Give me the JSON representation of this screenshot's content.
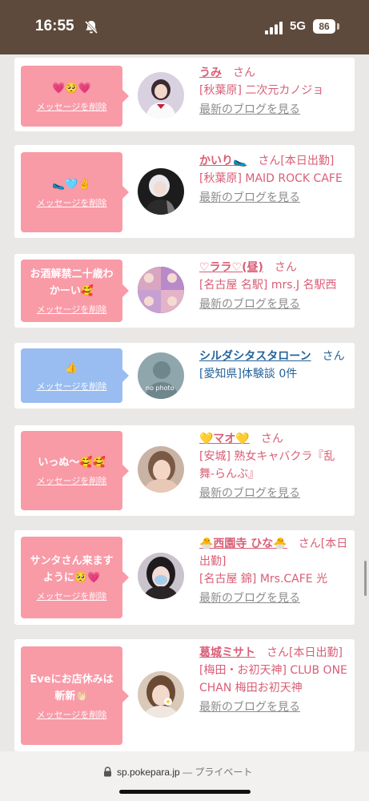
{
  "status_bar": {
    "time": "16:55",
    "network": "5G",
    "battery": "86"
  },
  "url_bar": {
    "domain": "sp.pokepara.jp",
    "suffix": "— プライベート"
  },
  "cards": [
    {
      "message": "💗🥺💗",
      "delete_label": "メッセージを削除",
      "name": "うみ",
      "name_suffix": "さん",
      "location": "[秋葉原] 二次元カノジョ",
      "blog_link": "最新のブログを見る"
    },
    {
      "message": "🥿🩵✌️",
      "delete_label": "メッセージを削除",
      "name": "かいり🥿",
      "name_suffix": "さん[本日出勤]",
      "location": "[秋葉原] MAID ROCK CAFE",
      "blog_link": "最新のブログを見る"
    },
    {
      "message": "お酒解禁二十歳わかーい🥰",
      "delete_label": "メッセージを削除",
      "name": "♡ララ♡(昼)",
      "name_suffix": "さん",
      "location": "[名古屋 名駅] mrs.J 名駅西",
      "blog_link": "最新のブログを見る"
    },
    {
      "message": "👍",
      "delete_label": "メッセージを削除",
      "name": "シルダシタスタローン",
      "name_suffix": "さん",
      "location": "[愛知県]体験談 0件",
      "avatar_text": "no photo"
    },
    {
      "message": "いっぬ〜🥰🥰",
      "delete_label": "メッセージを削除",
      "name": "💛マオ💛",
      "name_suffix": "さん",
      "location": "[安城] 熟女キャバクラ『乱舞-らんぶ』",
      "blog_link": "最新のブログを見る"
    },
    {
      "message": "サンタさん来ますように🥺💗",
      "delete_label": "メッセージを削除",
      "name": "🐣西園寺 ひな🐣",
      "name_suffix": "さん[本日出勤]",
      "location": "[名古屋 錦] Mrs.CAFE 光",
      "blog_link": "最新のブログを見る"
    },
    {
      "message": "Eveにお店休みは斬新👏🏻",
      "delete_label": "メッセージを削除",
      "name": "葛城ミサト",
      "name_suffix": "さん[本日出勤]",
      "location": "[梅田・お初天神] CLUB ONE CHAN 梅田お初天神",
      "blog_link": "最新のブログを見る"
    }
  ],
  "colors": {
    "status_bar": "#5e4a3c",
    "pink_bubble": "#f99aa7",
    "blue_bubble": "#99bdf1",
    "name_pink": "#d95e76",
    "name_blue": "#25639b"
  }
}
